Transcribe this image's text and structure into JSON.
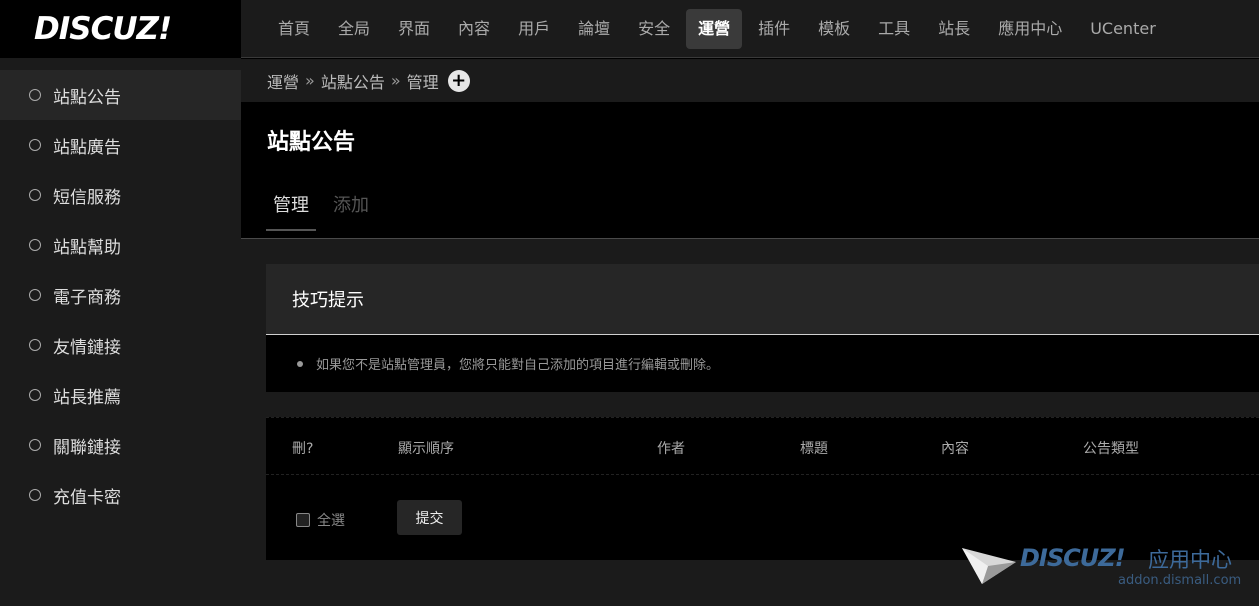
{
  "logo": {
    "text": "DISCUZ!"
  },
  "topnav": {
    "items": [
      "首頁",
      "全局",
      "界面",
      "內容",
      "用戶",
      "論壇",
      "安全",
      "運營",
      "插件",
      "模板",
      "工具",
      "站長",
      "應用中心",
      "UCenter"
    ],
    "active": "運營"
  },
  "sidebar": {
    "items": [
      {
        "label": "站點公告"
      },
      {
        "label": "站點廣告"
      },
      {
        "label": "短信服務"
      },
      {
        "label": "站點幫助"
      },
      {
        "label": "電子商務"
      },
      {
        "label": "友情鏈接"
      },
      {
        "label": "站長推薦"
      },
      {
        "label": "關聯鏈接"
      },
      {
        "label": "充值卡密"
      }
    ]
  },
  "breadcrumb": {
    "items": [
      "運營",
      "站點公告",
      "管理"
    ],
    "separator": "»"
  },
  "page": {
    "title": "站點公告",
    "tabs": [
      {
        "label": "管理"
      },
      {
        "label": "添加"
      }
    ]
  },
  "tips": {
    "title": "技巧提示",
    "text": "如果您不是站點管理員，您將只能對自己添加的項目進行編輯或刪除。"
  },
  "table": {
    "columns": [
      "刪?",
      "顯示順序",
      "作者",
      "標題",
      "內容",
      "公告類型"
    ],
    "select_all": "全選",
    "submit": "提交"
  },
  "watermark": {
    "brand": "DISCUZ!",
    "app": "应用中心",
    "url": "addon.dismall.com"
  },
  "colors": {
    "background": "#000000",
    "panel": "#1b1b1b",
    "active_nav": "#3a3a3a",
    "watermark": "#3d6a9a"
  }
}
